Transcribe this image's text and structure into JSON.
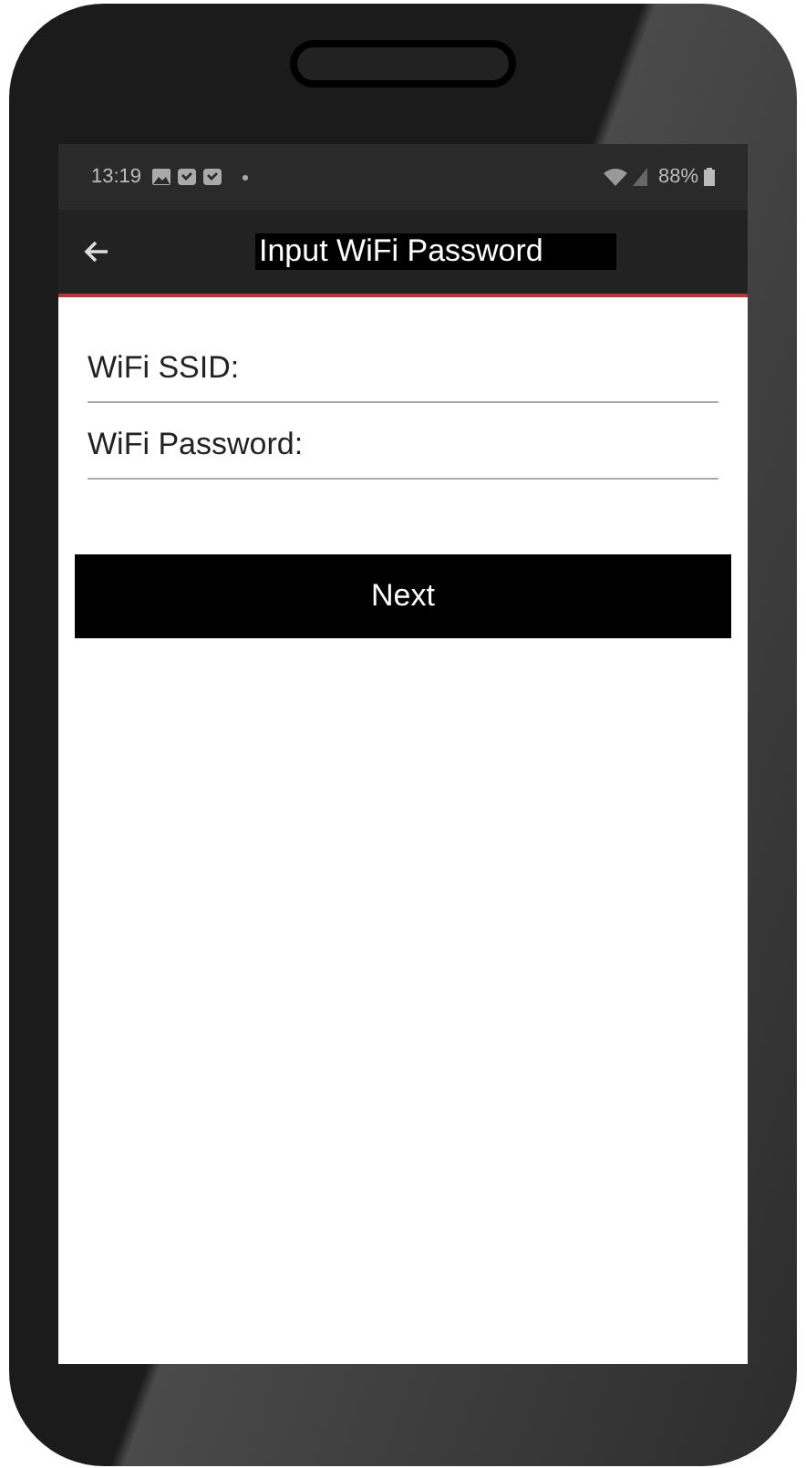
{
  "status_bar": {
    "time": "13:19",
    "battery": "88%"
  },
  "app_bar": {
    "title": "Input WiFi Password"
  },
  "fields": [
    {
      "placeholder": "WiFi SSID:"
    },
    {
      "placeholder": "WiFi Password:"
    }
  ],
  "button": {
    "label": "Next"
  }
}
